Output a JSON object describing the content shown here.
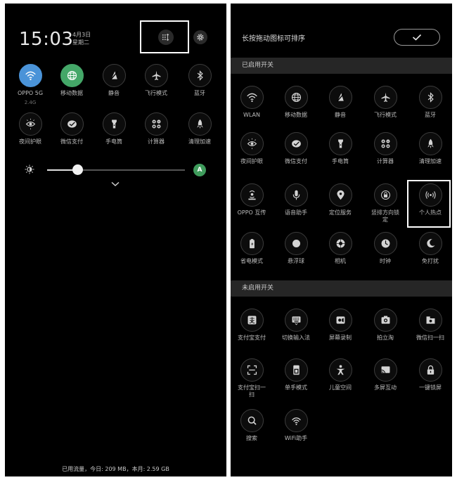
{
  "left_panel": {
    "time": "15:03",
    "date_line1": "4月3日",
    "date_line2": "星期二",
    "toggles": [
      {
        "label": "OPPO 5G",
        "sub": "2.4G",
        "state": "on-blue",
        "icon": "wifi-icon"
      },
      {
        "label": "移动数据",
        "state": "on-green",
        "icon": "globe-icon"
      },
      {
        "label": "静音",
        "icon": "mute-icon"
      },
      {
        "label": "飞行模式",
        "icon": "airplane-icon"
      },
      {
        "label": "蓝牙",
        "icon": "bluetooth-icon"
      },
      {
        "label": "夜间护眼",
        "icon": "eye-care-icon"
      },
      {
        "label": "微信支付",
        "icon": "wechat-pay-icon"
      },
      {
        "label": "手电筒",
        "icon": "flashlight-icon"
      },
      {
        "label": "计算器",
        "icon": "calculator-icon"
      },
      {
        "label": "清理加速",
        "icon": "rocket-icon"
      }
    ],
    "brightness": {
      "level": 0.22,
      "auto_label": "A"
    },
    "data_usage": "已用流量，今日: 209 MB，本月: 2.59 GB"
  },
  "right_panel": {
    "hint": "长按拖动图标可排序",
    "enabled_header": "已启用开关",
    "disabled_header": "未启用开关",
    "enabled": [
      {
        "label": "WLAN",
        "icon": "wifi-icon"
      },
      {
        "label": "移动数据",
        "icon": "globe-icon"
      },
      {
        "label": "静音",
        "icon": "mute-icon"
      },
      {
        "label": "飞行模式",
        "icon": "airplane-icon"
      },
      {
        "label": "蓝牙",
        "icon": "bluetooth-icon"
      },
      {
        "label": "夜间护眼",
        "icon": "eye-care-icon"
      },
      {
        "label": "微信支付",
        "icon": "wechat-pay-icon"
      },
      {
        "label": "手电筒",
        "icon": "flashlight-icon"
      },
      {
        "label": "计算器",
        "icon": "calculator-icon"
      },
      {
        "label": "清理加速",
        "icon": "rocket-icon"
      },
      {
        "label": "OPPO 互传",
        "icon": "share-icon"
      },
      {
        "label": "语音助手",
        "icon": "microphone-icon"
      },
      {
        "label": "定位服务",
        "icon": "location-icon"
      },
      {
        "label": "竖排方向锁",
        "label2": "定",
        "icon": "rotation-lock-icon"
      },
      {
        "label": "个人热点",
        "icon": "hotspot-icon"
      },
      {
        "label": "省电模式",
        "icon": "battery-icon"
      },
      {
        "label": "悬浮球",
        "icon": "floating-ball-icon"
      },
      {
        "label": "相机",
        "icon": "camera-icon"
      },
      {
        "label": "时钟",
        "icon": "clock-icon"
      },
      {
        "label": "免打扰",
        "icon": "moon-icon"
      }
    ],
    "disabled": [
      {
        "label": "支付宝支付",
        "icon": "alipay-icon"
      },
      {
        "label": "切换输入法",
        "icon": "keyboard-icon"
      },
      {
        "label": "屏幕录制",
        "icon": "screen-record-icon"
      },
      {
        "label": "拍立淘",
        "icon": "photo-search-icon"
      },
      {
        "label": "微信扫一扫",
        "icon": "wechat-scan-icon"
      },
      {
        "label": "支付宝扫一",
        "label2": "扫",
        "icon": "alipay-scan-icon"
      },
      {
        "label": "单手模式",
        "icon": "one-hand-icon"
      },
      {
        "label": "儿童空间",
        "icon": "child-space-icon"
      },
      {
        "label": "多屏互动",
        "icon": "cast-icon"
      },
      {
        "label": "一键锁屏",
        "icon": "lock-icon"
      },
      {
        "label": "搜索",
        "icon": "search-icon"
      },
      {
        "label": "WiFi助手",
        "icon": "wifi-assist-icon"
      }
    ]
  }
}
